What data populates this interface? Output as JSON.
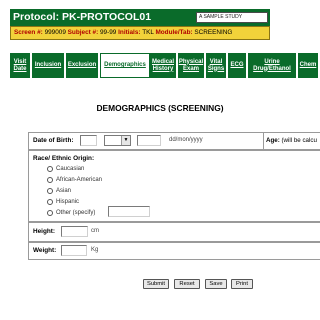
{
  "header": {
    "protocol_title": "Protocol: PK-PROTOCOL01",
    "sample_badge": "A SAMPLE STUDY",
    "screen_label": "Screen #:",
    "screen_value": "999009",
    "subject_label": "Subject #:",
    "subject_value": "99-99",
    "initials_label": "Initials:",
    "initials_value": "TKL",
    "module_label": "Module/Tab:",
    "module_value": "SCREENING"
  },
  "nav": {
    "tabs": [
      {
        "label": "Visit Date"
      },
      {
        "label": "Inclusion"
      },
      {
        "label": "Exclusion"
      },
      {
        "label": "Demographics"
      },
      {
        "label": "Medical History"
      },
      {
        "label": "Physical Exam"
      },
      {
        "label": "Vital Signs"
      },
      {
        "label": "ECG"
      },
      {
        "label": "Urine Drug/Ethanol"
      },
      {
        "label": "Chem"
      }
    ],
    "active_index": 3
  },
  "page_title": "DEMOGRAPHICS (SCREENING)",
  "form": {
    "dob_label": "Date of Birth:",
    "dob_format": "dd/mon/yyyy",
    "age_label": "Age:",
    "age_hint": "(will be calcu",
    "race_label": "Race/ Ethnic Origin:",
    "race_options": [
      "Caucasian",
      "African-American",
      "Asian",
      "Hispanic",
      "Other (specify)"
    ],
    "height_label": "Height:",
    "height_unit": "cm",
    "weight_label": "Weight:",
    "weight_unit": "Kg"
  },
  "buttons": {
    "submit": "Submit",
    "reset": "Reset",
    "save": "Save",
    "print": "Print"
  },
  "colors": {
    "header_green": "#0a6b2a",
    "screen_bar_yellow": "#f2d23a",
    "label_red": "#b00000"
  }
}
